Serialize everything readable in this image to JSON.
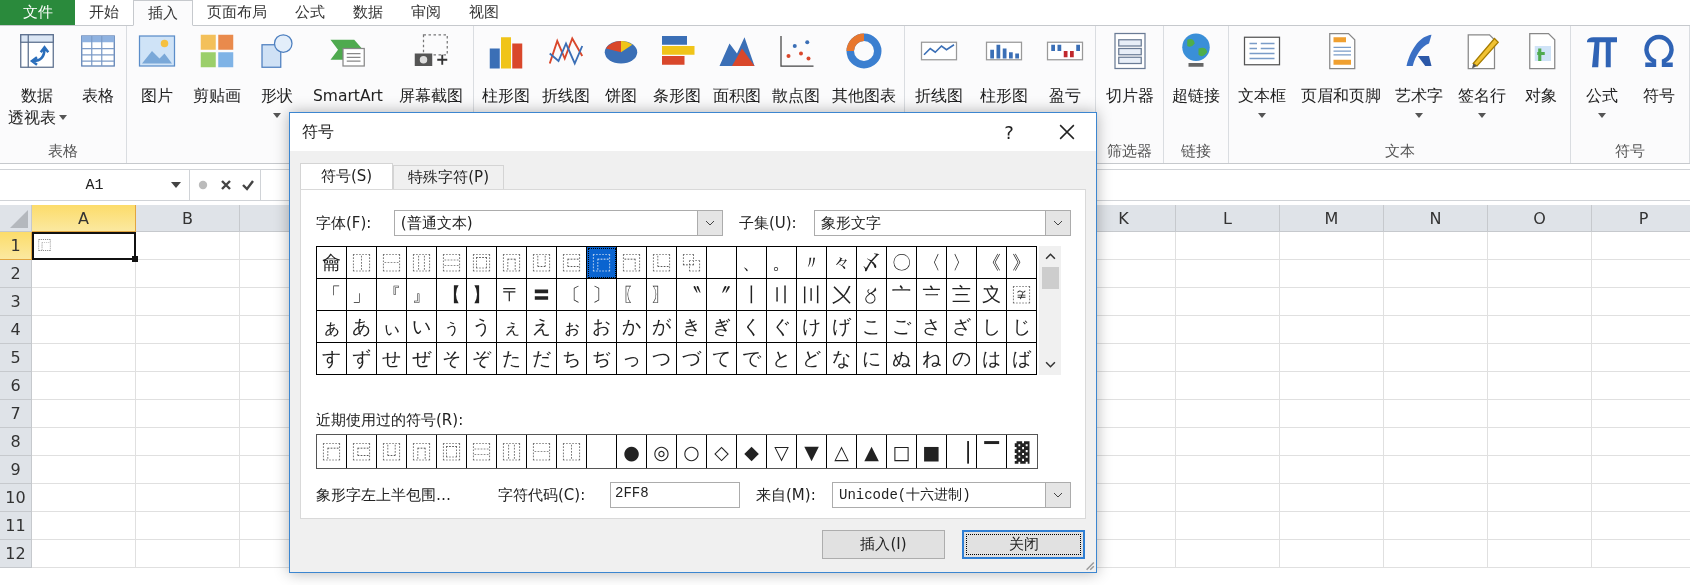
{
  "tabs": [
    {
      "label": "文件",
      "kind": "file",
      "selected": false
    },
    {
      "label": "开始",
      "kind": "tab",
      "selected": false
    },
    {
      "label": "插入",
      "kind": "tab",
      "selected": true
    },
    {
      "label": "页面布局",
      "kind": "tab",
      "selected": false
    },
    {
      "label": "公式",
      "kind": "tab",
      "selected": false
    },
    {
      "label": "数据",
      "kind": "tab",
      "selected": false
    },
    {
      "label": "审阅",
      "kind": "tab",
      "selected": false
    },
    {
      "label": "视图",
      "kind": "tab",
      "selected": false
    }
  ],
  "ribbon_groups": [
    {
      "label": "表格",
      "items": [
        {
          "label": [
            "数据",
            "透视表"
          ],
          "dropdown": true
        },
        {
          "label": [
            "表格"
          ],
          "dropdown": false
        }
      ]
    },
    {
      "items": [
        {
          "label": [
            "图片"
          ],
          "dropdown": false
        },
        {
          "label": [
            "剪贴画"
          ],
          "dropdown": false
        },
        {
          "label": [
            "形状"
          ],
          "dropdown": true
        },
        {
          "label": [
            "SmartArt"
          ],
          "dropdown": false
        },
        {
          "label": [
            "屏幕截图"
          ],
          "dropdown": false
        }
      ]
    },
    {
      "items": [
        {
          "label": [
            "柱形图"
          ],
          "dropdown": false
        },
        {
          "label": [
            "折线图"
          ],
          "dropdown": false
        },
        {
          "label": [
            "饼图"
          ],
          "dropdown": false
        },
        {
          "label": [
            "条形图"
          ],
          "dropdown": false
        },
        {
          "label": [
            "面积图"
          ],
          "dropdown": false
        },
        {
          "label": [
            "散点图"
          ],
          "dropdown": false
        },
        {
          "label": [
            "其他图表"
          ],
          "dropdown": false
        }
      ]
    },
    {
      "items": [
        {
          "label": [
            "折线图"
          ],
          "dropdown": false
        },
        {
          "label": [
            "柱形图"
          ],
          "dropdown": false
        },
        {
          "label": [
            "盈亏"
          ],
          "dropdown": false
        }
      ]
    },
    {
      "label": "筛选器",
      "items": [
        {
          "label": [
            "切片器"
          ],
          "dropdown": false
        }
      ]
    },
    {
      "label": "链接",
      "items": [
        {
          "label": [
            "超链接"
          ],
          "dropdown": false
        }
      ]
    },
    {
      "label": "文本",
      "items": [
        {
          "label": [
            "文本框"
          ],
          "dropdown": true
        },
        {
          "label": [
            "页眉和页脚"
          ],
          "dropdown": false
        },
        {
          "label": [
            "艺术字"
          ],
          "dropdown": true
        },
        {
          "label": [
            "签名行"
          ],
          "dropdown": true
        },
        {
          "label": [
            "对象"
          ],
          "dropdown": false
        }
      ]
    },
    {
      "label": "符号",
      "items": [
        {
          "label": [
            "公式"
          ],
          "dropdown": true
        },
        {
          "label": [
            "符号"
          ],
          "dropdown": false
        }
      ]
    }
  ],
  "formula_bar": {
    "name_box": "A1"
  },
  "sheet": {
    "columns_left": [
      {
        "label": "A",
        "selected": true
      },
      {
        "label": "B",
        "selected": false
      }
    ],
    "columns_right": [
      {
        "label": "K",
        "selected": false
      },
      {
        "label": "L",
        "selected": false
      },
      {
        "label": "M",
        "selected": false
      },
      {
        "label": "N",
        "selected": false
      },
      {
        "label": "O",
        "selected": false
      },
      {
        "label": "P",
        "selected": false
      }
    ],
    "rows": [
      {
        "label": "1",
        "selected": true
      },
      {
        "label": "2",
        "selected": false
      },
      {
        "label": "3",
        "selected": false
      },
      {
        "label": "4",
        "selected": false
      },
      {
        "label": "5",
        "selected": false
      },
      {
        "label": "6",
        "selected": false
      },
      {
        "label": "7",
        "selected": false
      },
      {
        "label": "8",
        "selected": false
      },
      {
        "label": "9",
        "selected": false
      },
      {
        "label": "10",
        "selected": false
      },
      {
        "label": "11",
        "selected": false
      },
      {
        "label": "12",
        "selected": false
      }
    ],
    "active_cell": {
      "value": "⿸"
    }
  },
  "dialog": {
    "title": "符号",
    "help": "?",
    "tabs": [
      {
        "label": "符号(S)",
        "selected": true
      },
      {
        "label": "特殊字符(P)",
        "selected": false
      }
    ],
    "font": {
      "label": "字体(F):",
      "value": "(普通文本)"
    },
    "subset": {
      "label": "子集(U):",
      "value": "象形文字"
    },
    "grid": [
      {
        "cells": [
          {
            "char": "⿕",
            "selected": false
          },
          {
            "char": "⿰",
            "selected": false
          },
          {
            "char": "⿱",
            "selected": false
          },
          {
            "char": "⿲",
            "selected": false
          },
          {
            "char": "⿳",
            "selected": false
          },
          {
            "char": "⿴",
            "selected": false
          },
          {
            "char": "⿵",
            "selected": false
          },
          {
            "char": "⿶",
            "selected": false
          },
          {
            "char": "⿷",
            "selected": false
          },
          {
            "char": "⿸",
            "selected": true
          },
          {
            "char": "⿹",
            "selected": false
          },
          {
            "char": "⿺",
            "selected": false
          },
          {
            "char": "⿻",
            "selected": false
          },
          {
            "selected": false
          },
          {
            "char": "、",
            "selected": false
          },
          {
            "char": "。",
            "selected": false
          },
          {
            "char": "〃",
            "selected": false
          },
          {
            "char": "々",
            "selected": false
          },
          {
            "char": "〆",
            "selected": false
          },
          {
            "char": "〇",
            "selected": false
          },
          {
            "char": "〈",
            "selected": false
          },
          {
            "char": "〉",
            "selected": false
          },
          {
            "char": "《",
            "selected": false
          },
          {
            "char": "》",
            "selected": false
          }
        ]
      },
      {
        "cells": [
          {
            "char": "「",
            "selected": false
          },
          {
            "char": "」",
            "selected": false
          },
          {
            "char": "『",
            "selected": false
          },
          {
            "char": "』",
            "selected": false
          },
          {
            "char": "【",
            "selected": false
          },
          {
            "char": "】",
            "selected": false
          },
          {
            "char": "〒",
            "selected": false
          },
          {
            "char": "〓",
            "selected": false
          },
          {
            "char": "〔",
            "selected": false
          },
          {
            "char": "〕",
            "selected": false
          },
          {
            "char": "〖",
            "selected": false
          },
          {
            "char": "〗",
            "selected": false
          },
          {
            "char": "〝",
            "selected": false
          },
          {
            "char": "〞",
            "selected": false
          },
          {
            "char": "〡",
            "selected": false
          },
          {
            "char": "〢",
            "selected": false
          },
          {
            "char": "〣",
            "selected": false
          },
          {
            "char": "〤",
            "selected": false
          },
          {
            "char": "〥",
            "selected": false
          },
          {
            "char": "〦",
            "selected": false
          },
          {
            "char": "〧",
            "selected": false
          },
          {
            "char": "〨",
            "selected": false
          },
          {
            "char": "〩",
            "selected": false
          },
          {
            "char": "〾",
            "selected": false
          }
        ]
      },
      {
        "cells": [
          {
            "char": "ぁ",
            "selected": false
          },
          {
            "char": "あ",
            "selected": false
          },
          {
            "char": "ぃ",
            "selected": false
          },
          {
            "char": "い",
            "selected": false
          },
          {
            "char": "ぅ",
            "selected": false
          },
          {
            "char": "う",
            "selected": false
          },
          {
            "char": "ぇ",
            "selected": false
          },
          {
            "char": "え",
            "selected": false
          },
          {
            "char": "ぉ",
            "selected": false
          },
          {
            "char": "お",
            "selected": false
          },
          {
            "char": "か",
            "selected": false
          },
          {
            "char": "が",
            "selected": false
          },
          {
            "char": "き",
            "selected": false
          },
          {
            "char": "ぎ",
            "selected": false
          },
          {
            "char": "く",
            "selected": false
          },
          {
            "char": "ぐ",
            "selected": false
          },
          {
            "char": "け",
            "selected": false
          },
          {
            "char": "げ",
            "selected": false
          },
          {
            "char": "こ",
            "selected": false
          },
          {
            "char": "ご",
            "selected": false
          },
          {
            "char": "さ",
            "selected": false
          },
          {
            "char": "ざ",
            "selected": false
          },
          {
            "char": "し",
            "selected": false
          },
          {
            "char": "じ",
            "selected": false
          }
        ]
      },
      {
        "cells": [
          {
            "char": "す",
            "selected": false
          },
          {
            "char": "ず",
            "selected": false
          },
          {
            "char": "せ",
            "selected": false
          },
          {
            "char": "ぜ",
            "selected": false
          },
          {
            "char": "そ",
            "selected": false
          },
          {
            "char": "ぞ",
            "selected": false
          },
          {
            "char": "た",
            "selected": false
          },
          {
            "char": "だ",
            "selected": false
          },
          {
            "char": "ち",
            "selected": false
          },
          {
            "char": "ぢ",
            "selected": false
          },
          {
            "char": "っ",
            "selected": false
          },
          {
            "char": "つ",
            "selected": false
          },
          {
            "char": "づ",
            "selected": false
          },
          {
            "char": "て",
            "selected": false
          },
          {
            "char": "で",
            "selected": false
          },
          {
            "char": "と",
            "selected": false
          },
          {
            "char": "ど",
            "selected": false
          },
          {
            "char": "な",
            "selected": false
          },
          {
            "char": "に",
            "selected": false
          },
          {
            "char": "ぬ",
            "selected": false
          },
          {
            "char": "ね",
            "selected": false
          },
          {
            "char": "の",
            "selected": false
          },
          {
            "char": "は",
            "selected": false
          },
          {
            "char": "ば",
            "selected": false
          }
        ]
      }
    ],
    "recent": {
      "label": "近期使用过的符号(R):",
      "symbols": [
        {
          "kind": "symbol",
          "char": "⿸"
        },
        {
          "kind": "symbol",
          "char": "⿷"
        },
        {
          "kind": "symbol",
          "char": "⿶"
        },
        {
          "kind": "symbol",
          "char": "⿵"
        },
        {
          "kind": "symbol",
          "char": "⿴"
        },
        {
          "kind": "symbol",
          "char": "⿳"
        },
        {
          "kind": "symbol",
          "char": "⿲"
        },
        {
          "kind": "symbol",
          "char": "⿱"
        },
        {
          "kind": "symbol",
          "char": "⿰"
        },
        {
          "kind": "blank"
        },
        {
          "kind": "symbol",
          "char": "●"
        },
        {
          "kind": "symbol",
          "char": "◎"
        },
        {
          "kind": "symbol",
          "char": "○"
        },
        {
          "kind": "symbol",
          "char": "◇"
        },
        {
          "kind": "symbol",
          "char": "◆"
        },
        {
          "kind": "symbol",
          "char": "▽"
        },
        {
          "kind": "symbol",
          "char": "▼"
        },
        {
          "kind": "symbol",
          "char": "△"
        },
        {
          "kind": "symbol",
          "char": "▲"
        },
        {
          "kind": "symbol",
          "char": "□"
        },
        {
          "kind": "symbol",
          "char": "■"
        },
        {
          "kind": "symbol",
          "char": "▕"
        },
        {
          "kind": "symbol",
          "char": "▔"
        },
        {
          "kind": "symbol",
          "char": "▓"
        }
      ]
    },
    "description": "象形字左上半包围…",
    "char_code": {
      "label": "字符代码(C):",
      "value": "2FF8"
    },
    "from": {
      "label": "来自(M):",
      "value": "Unicode(十六进制)"
    },
    "buttons": [
      {
        "label": "插入(I)",
        "default": false
      },
      {
        "label": "关闭",
        "default": true
      }
    ]
  }
}
